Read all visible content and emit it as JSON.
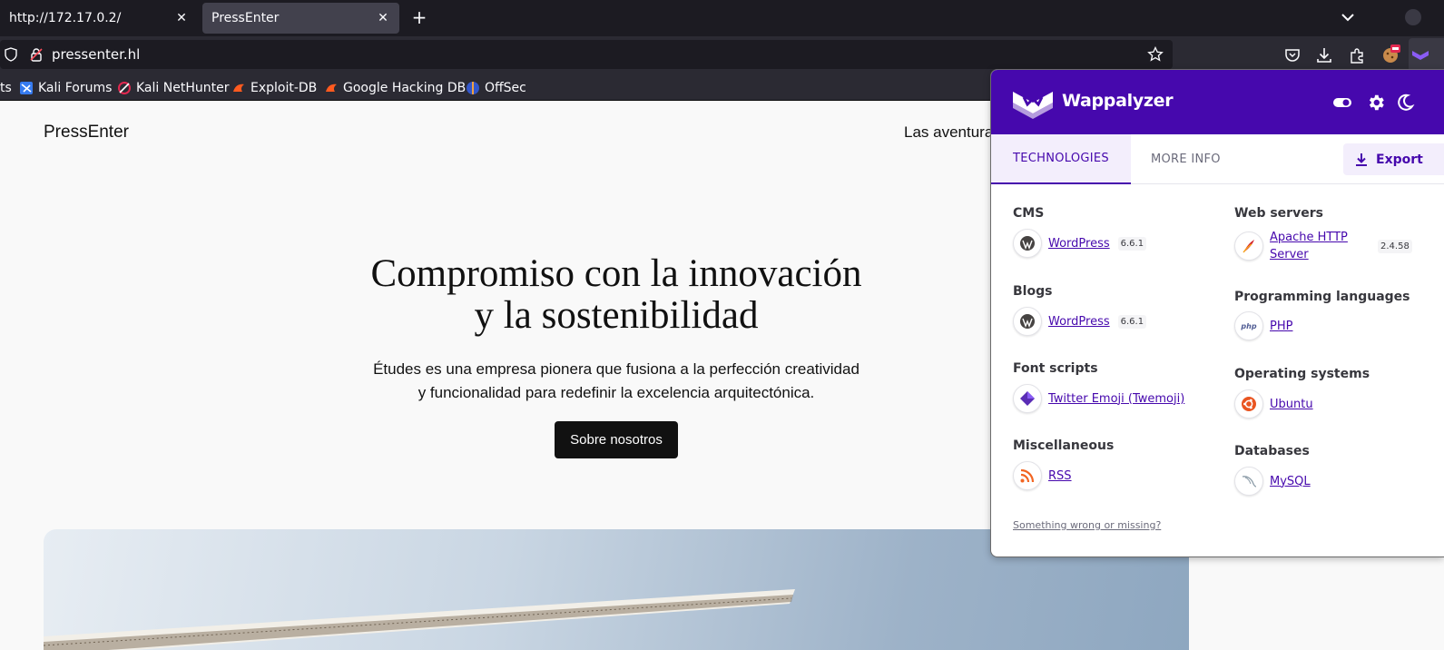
{
  "browser": {
    "tabs": [
      {
        "title": "http://172.17.0.2/",
        "active": false
      },
      {
        "title": "PressEnter",
        "active": true
      }
    ],
    "new_tab": "+",
    "url": "pressenter.hl",
    "bookmarks": [
      {
        "label": "ts",
        "icon": "kali-icon"
      },
      {
        "label": "Kali Forums",
        "icon": "kali-forums-icon"
      },
      {
        "label": "Kali NetHunter",
        "icon": "nethunter-icon"
      },
      {
        "label": "Exploit-DB",
        "icon": "exploit-db-icon"
      },
      {
        "label": "Google Hacking DB",
        "icon": "ghdb-icon"
      },
      {
        "label": "OffSec",
        "icon": "offsec-icon"
      }
    ]
  },
  "site": {
    "title": "PressEnter",
    "nav_link": "Las aventuras",
    "hero_title_line1": "Compromiso con la innovación",
    "hero_title_line2": "y la sostenibilidad",
    "hero_sub_line1": "Études es una empresa pionera que fusiona a la perfección creatividad",
    "hero_sub_line2": "y funcionalidad para redefinir la excelencia arquitectónica.",
    "hero_button": "Sobre nosotros"
  },
  "wappalyzer": {
    "name": "Wappalyzer",
    "brand_color": "#4608ad",
    "tabs": {
      "technologies": "TECHNOLOGIES",
      "more_info": "MORE INFO"
    },
    "export_label": "Export",
    "left_column": [
      {
        "category": "CMS",
        "techs": [
          {
            "name": "WordPress",
            "version": "6.6.1",
            "icon": "wordpress-icon"
          }
        ]
      },
      {
        "category": "Blogs",
        "techs": [
          {
            "name": "WordPress",
            "version": "6.6.1",
            "icon": "wordpress-icon"
          }
        ]
      },
      {
        "category": "Font scripts",
        "techs": [
          {
            "name": "Twitter Emoji (Twemoji)",
            "version": "",
            "icon": "twemoji-icon"
          }
        ]
      },
      {
        "category": "Miscellaneous",
        "techs": [
          {
            "name": "RSS",
            "version": "",
            "icon": "rss-icon"
          }
        ]
      }
    ],
    "right_column": [
      {
        "category": "Web servers",
        "techs": [
          {
            "name_line1": "Apache HTTP",
            "name_line2": "Server",
            "version": "2.4.58",
            "icon": "apache-icon"
          }
        ]
      },
      {
        "category": "Programming languages",
        "techs": [
          {
            "name": "PHP",
            "version": "",
            "icon": "php-icon"
          }
        ]
      },
      {
        "category": "Operating systems",
        "techs": [
          {
            "name": "Ubuntu",
            "version": "",
            "icon": "ubuntu-icon"
          }
        ]
      },
      {
        "category": "Databases",
        "techs": [
          {
            "name": "MySQL",
            "version": "",
            "icon": "mysql-icon"
          }
        ]
      }
    ],
    "footer_link": "Something wrong or missing?"
  }
}
